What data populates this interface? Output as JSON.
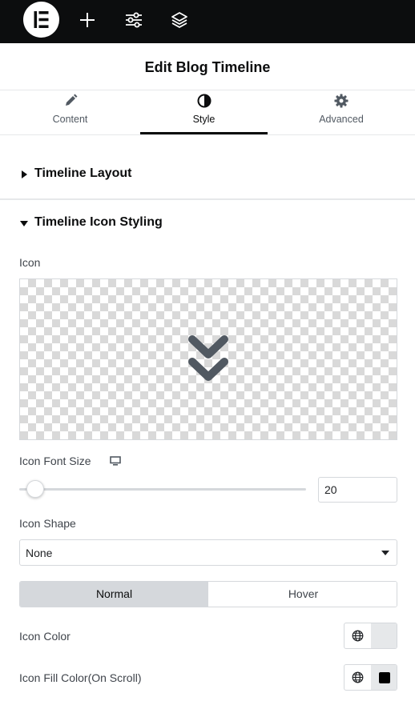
{
  "topbar": {
    "logo_icon": "elementor-logo-icon",
    "buttons": [
      {
        "name": "add-element",
        "icon": "plus-icon"
      },
      {
        "name": "site-settings",
        "icon": "sliders-icon"
      },
      {
        "name": "structure",
        "icon": "layers-icon"
      }
    ]
  },
  "header": {
    "title": "Edit Blog Timeline"
  },
  "tabs": [
    {
      "label": "Content",
      "icon": "pencil-icon",
      "active": false
    },
    {
      "label": "Style",
      "icon": "contrast-icon",
      "active": true
    },
    {
      "label": "Advanced",
      "icon": "gear-icon",
      "active": false
    }
  ],
  "sections": [
    {
      "title": "Timeline Layout",
      "expanded": false
    },
    {
      "title": "Timeline Icon Styling",
      "expanded": true
    }
  ],
  "controls": {
    "icon": {
      "label": "Icon",
      "preview_icon": "double-chevron-down-icon"
    },
    "font_size": {
      "label": "Icon Font Size",
      "device_icon": "desktop-icon",
      "value": "20",
      "slider_fraction": 0.04
    },
    "shape": {
      "label": "Icon Shape",
      "value": "None"
    },
    "state_toggle": {
      "normal": "Normal",
      "hover": "Hover",
      "active": "Normal"
    },
    "icon_color": {
      "label": "Icon Color",
      "swatch_color": "#e6e8ea"
    },
    "fill_color": {
      "label": "Icon Fill Color(On Scroll)",
      "swatch_color": "#000000"
    }
  },
  "colors": {
    "accent": "#0c0d0e",
    "border": "#d5d8dc",
    "topbar": "#0c0d0e"
  }
}
